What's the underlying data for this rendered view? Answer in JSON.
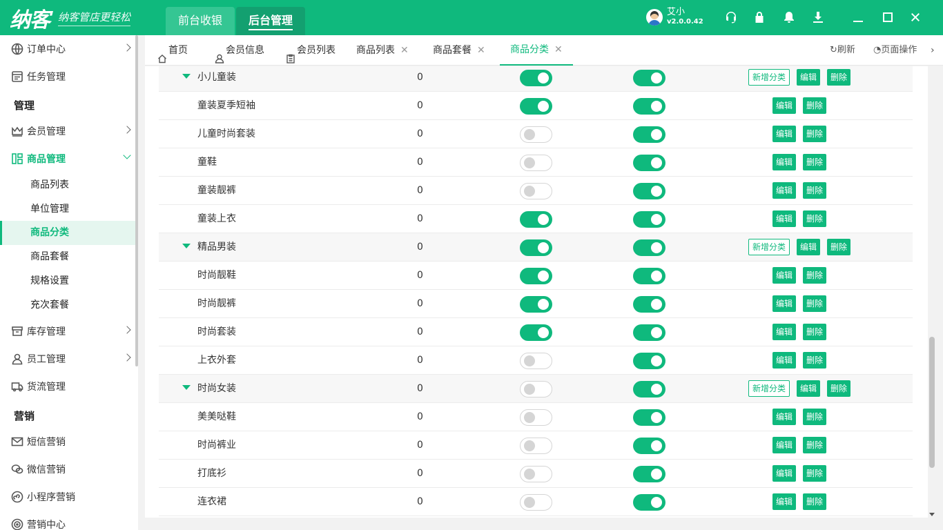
{
  "header": {
    "logo": "纳客",
    "slogan": "纳客管店更轻松",
    "tabs": [
      "前台收银",
      "后台管理"
    ],
    "user_name": "艾小",
    "version": "v2.0.0.42",
    "icons": [
      "headset-icon",
      "lock-icon",
      "bell-icon",
      "download-icon",
      "minimize-icon",
      "maximize-icon",
      "close-icon"
    ]
  },
  "sidebar": {
    "items": [
      {
        "label": "订单中心",
        "icon": "globe-icon"
      },
      {
        "label": "任务管理",
        "icon": "task-icon"
      }
    ],
    "group1": "管理",
    "items2": [
      {
        "label": "会员管理",
        "icon": "crown-icon"
      },
      {
        "label": "商品管理",
        "icon": "layout-icon"
      }
    ],
    "subitems": [
      "商品列表",
      "单位管理",
      "商品分类",
      "商品套餐",
      "规格设置",
      "充次套餐"
    ],
    "items3": [
      {
        "label": "库存管理",
        "icon": "box-icon"
      },
      {
        "label": "员工管理",
        "icon": "person-icon"
      },
      {
        "label": "货流管理",
        "icon": "truck-icon"
      }
    ],
    "group2": "营销",
    "items4": [
      {
        "label": "短信营销",
        "icon": "mail-icon"
      },
      {
        "label": "微信营销",
        "icon": "wechat-icon"
      },
      {
        "label": "小程序营销",
        "icon": "miniapp-icon"
      },
      {
        "label": "营销中心",
        "icon": "target-icon"
      }
    ]
  },
  "tabs": {
    "items": [
      "首页",
      "会员信息",
      "会员列表",
      "商品列表",
      "商品套餐",
      "商品分类"
    ],
    "refresh": "刷新",
    "page_ops": "页面操作"
  },
  "actions": {
    "add": "新增分类",
    "edit": "编辑",
    "delete": "删除"
  },
  "rows": [
    {
      "name": "小儿童装",
      "count": "0",
      "s1": true,
      "s2": true,
      "parent": true
    },
    {
      "name": "童装夏季短袖",
      "count": "0",
      "s1": true,
      "s2": true,
      "parent": false
    },
    {
      "name": "儿童时尚套装",
      "count": "0",
      "s1": false,
      "s2": true,
      "parent": false
    },
    {
      "name": "童鞋",
      "count": "0",
      "s1": false,
      "s2": true,
      "parent": false
    },
    {
      "name": "童装靓裤",
      "count": "0",
      "s1": false,
      "s2": true,
      "parent": false
    },
    {
      "name": "童装上衣",
      "count": "0",
      "s1": true,
      "s2": true,
      "parent": false
    },
    {
      "name": "精品男装",
      "count": "0",
      "s1": true,
      "s2": true,
      "parent": true
    },
    {
      "name": "时尚靓鞋",
      "count": "0",
      "s1": true,
      "s2": true,
      "parent": false
    },
    {
      "name": "时尚靓裤",
      "count": "0",
      "s1": true,
      "s2": true,
      "parent": false
    },
    {
      "name": "时尚套装",
      "count": "0",
      "s1": true,
      "s2": true,
      "parent": false
    },
    {
      "name": "上衣外套",
      "count": "0",
      "s1": false,
      "s2": true,
      "parent": false
    },
    {
      "name": "时尚女装",
      "count": "0",
      "s1": false,
      "s2": true,
      "parent": true
    },
    {
      "name": "美美哒鞋",
      "count": "0",
      "s1": false,
      "s2": true,
      "parent": false
    },
    {
      "name": "时尚裤业",
      "count": "0",
      "s1": false,
      "s2": true,
      "parent": false
    },
    {
      "name": "打底衫",
      "count": "0",
      "s1": false,
      "s2": true,
      "parent": false
    },
    {
      "name": "连衣裙",
      "count": "0",
      "s1": false,
      "s2": true,
      "parent": false
    }
  ]
}
